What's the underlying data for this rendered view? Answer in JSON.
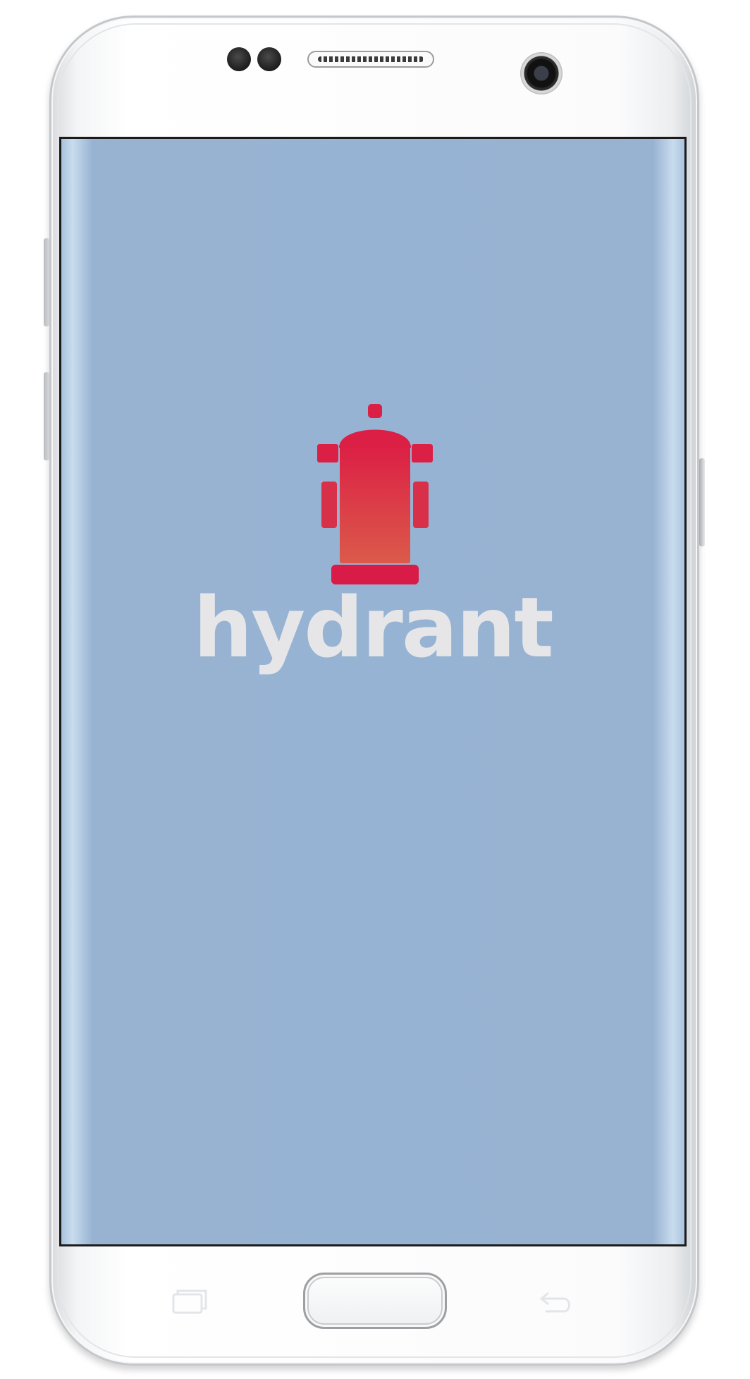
{
  "device": {
    "model": "android-phone-mockup"
  },
  "app": {
    "name": "hydrant",
    "logo_icon": "fire-hydrant-icon",
    "background_color": "#97b3d3",
    "logo_color_top": "#dc1f45",
    "logo_color_bottom": "#db5a4a",
    "wordmark_color": "#e6e6e8"
  },
  "hardware_buttons": {
    "home": "home-button",
    "recent": "recent-apps-icon",
    "back": "back-icon"
  }
}
